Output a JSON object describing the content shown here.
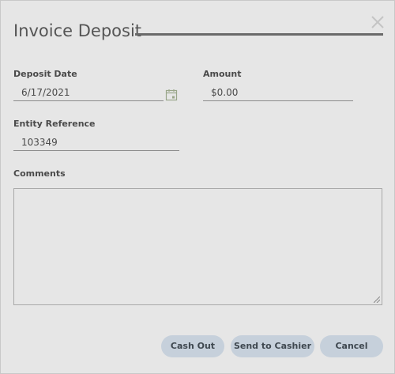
{
  "dialog": {
    "title": "Invoice Deposit"
  },
  "fields": {
    "deposit_date": {
      "label": "Deposit Date",
      "value": "6/17/2021"
    },
    "amount": {
      "label": "Amount",
      "value": "$0.00"
    },
    "entity_reference": {
      "label": "Entity Reference",
      "value": "103349"
    },
    "comments": {
      "label": "Comments",
      "value": ""
    }
  },
  "buttons": {
    "cash_out": "Cash Out",
    "send_to_cashier": "Send to Cashier",
    "cancel": "Cancel"
  },
  "colors": {
    "dialog_background": "#e6e6e6",
    "button_background": "#c6d0db",
    "title_rule": "#6a6a6a"
  },
  "icons": {
    "close": "close-icon",
    "calendar": "calendar-icon",
    "resize": "resize-grip-icon"
  }
}
